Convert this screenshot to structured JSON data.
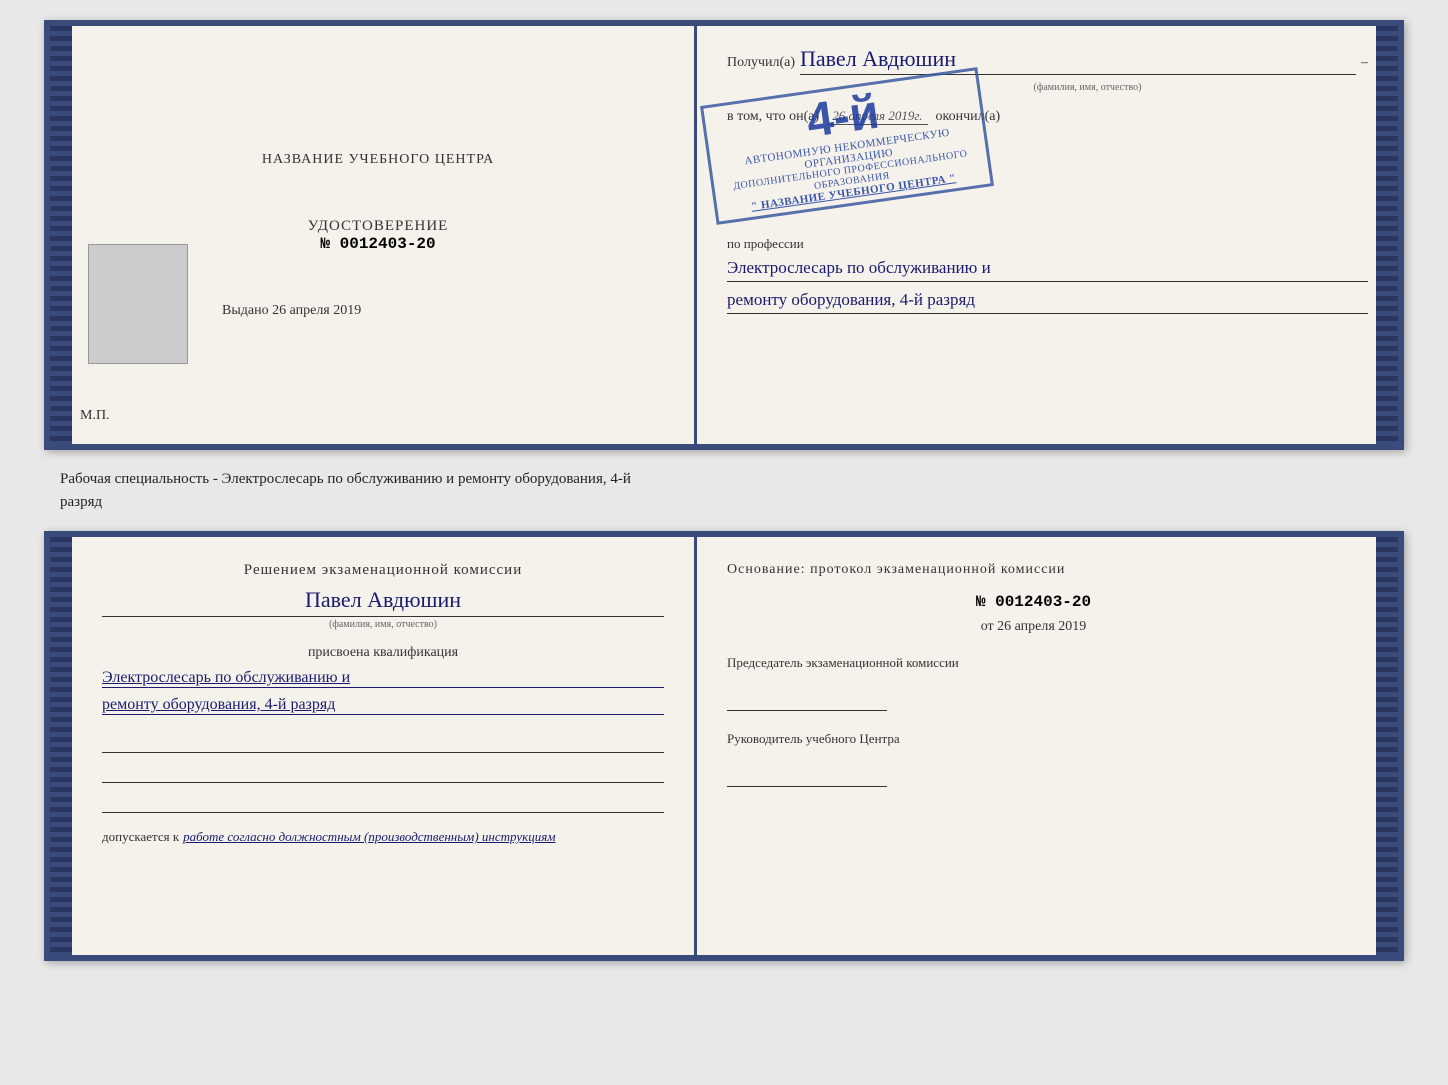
{
  "topDoc": {
    "left": {
      "centerTitle": "НАЗВАНИЕ УЧЕБНОГО ЦЕНТРА",
      "udostoverenie": "УДОСТОВЕРЕНИЕ",
      "number": "№ 0012403-20",
      "vydano": "Выдано",
      "vydanoDate": "26 апреля 2019",
      "mp": "М.П."
    },
    "right": {
      "poluchilLabel": "Получил(а)",
      "name": "Павел Авдюшин",
      "fioSubLabel": "(фамилия, имя, отчество)",
      "dash": "–",
      "vtomLabel": "в том, что он(а)",
      "date": "26 апреля 2019г.",
      "okonchilLabel": "окончил(а)",
      "stampGrade": "4-й",
      "stampLine1": "АВТОНОМНУЮ НЕКОММЕРЧЕСКУЮ ОРГАНИЗАЦИЮ",
      "stampLine2": "ДОПОЛНИТЕЛЬНОГО ПРОФЕССИОНАЛЬНОГО ОБРАЗОВАНИЯ",
      "stampLine3": "\" НАЗВАНИЕ УЧЕБНОГО ЦЕНТРА \"",
      "poProfessii": "по профессии",
      "prof1": "Электрослесарь по обслуживанию и",
      "prof2": "ремонту оборудования, 4-й разряд"
    }
  },
  "caption": {
    "line1": "Рабочая специальность - Электрослесарь по обслуживанию и ремонту оборудования, 4-й",
    "line2": "разряд"
  },
  "bottomDoc": {
    "left": {
      "resheniemTitle": "Решением экзаменационной  комиссии",
      "name": "Павел Авдюшин",
      "fioSubLabel": "(фамилия, имя, отчество)",
      "prisvoenaLabel": "присвоена квалификация",
      "kvali1": "Электрослесарь по обслуживанию и",
      "kvali2": "ремонту оборудования, 4-й разряд",
      "dopuskLabel": "допускается к",
      "dopuskValue": "работе согласно должностным (производственным) инструкциям"
    },
    "right": {
      "osnovanieTitlePrefix": "Основание: протокол экзаменационной  комиссии",
      "protocolNumber": "№  0012403-20",
      "ot": "от",
      "otDate": "26 апреля 2019",
      "predsedatelLabel": "Председатель экзаменационной комиссии",
      "rukovoditelLabel": "Руководитель учебного Центра"
    }
  }
}
